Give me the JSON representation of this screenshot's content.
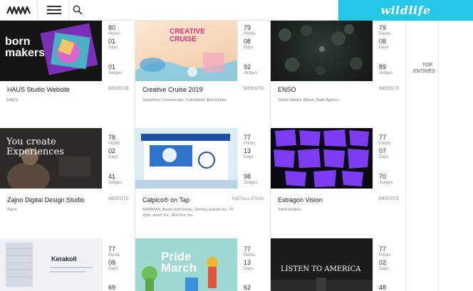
{
  "header": {
    "logo_alt": "AWWWARDS",
    "banner_text": "wildlife",
    "accent": "#24c8e6"
  },
  "side": {
    "top_label": "TOP",
    "entries_label": "ENTRIES"
  },
  "stat_labels": {
    "points": "Points",
    "days": "Days",
    "judges": "Judges"
  },
  "cards": [
    {
      "title": "HAUS Studio Website",
      "type": "WEBSITE",
      "credits": "HAUS",
      "points": "80",
      "days": "01",
      "judges": "01",
      "thumb_text": "born makers"
    },
    {
      "title": "Creative Cruise 2019",
      "type": "WEBSITE",
      "credits": "Superhero Cheesecake, Colorbleed, Bart Kokke",
      "points": "79",
      "days": "08",
      "judges": "92",
      "thumb_text": "CREATIVE CRUISE"
    },
    {
      "title": "ENSO",
      "type": "WEBSITE",
      "credits": "Stupid Studio, Abtion, Balls Agency",
      "points": "79",
      "days": "08",
      "judges": "89",
      "thumb_text": ""
    },
    {
      "title": "Zajno Digital Design Studio",
      "type": "WEBSITE",
      "credits": "Zajno",
      "points": "78",
      "days": "02",
      "judges": "41",
      "thumb_text": "You create Experiences"
    },
    {
      "title": "Calpico® on Tap",
      "type": "INSTALLATION",
      "credits": "BIRDMAN, Asahi Soft Drinks, Dentsu, puzzle Inc., R style, dwarf Inc., AOI Pro. Inc.",
      "points": "77",
      "days": "13",
      "judges": "98",
      "thumb_text": ""
    },
    {
      "title": "Estragon Vision",
      "type": "WEBSITE",
      "credits": "Stink Studios",
      "points": "77",
      "days": "07",
      "judges": "70",
      "thumb_text": ""
    },
    {
      "title": "",
      "type": "",
      "credits": "",
      "points": "77",
      "days": "08",
      "judges": "69",
      "thumb_text": "Kerakoll"
    },
    {
      "title": "",
      "type": "",
      "credits": "",
      "points": "77",
      "days": "13",
      "judges": "62",
      "thumb_text": "Pride March"
    },
    {
      "title": "",
      "type": "",
      "credits": "",
      "points": "77",
      "days": "02",
      "judges": "48",
      "thumb_text": "LISTEN TO AMERICA"
    }
  ]
}
